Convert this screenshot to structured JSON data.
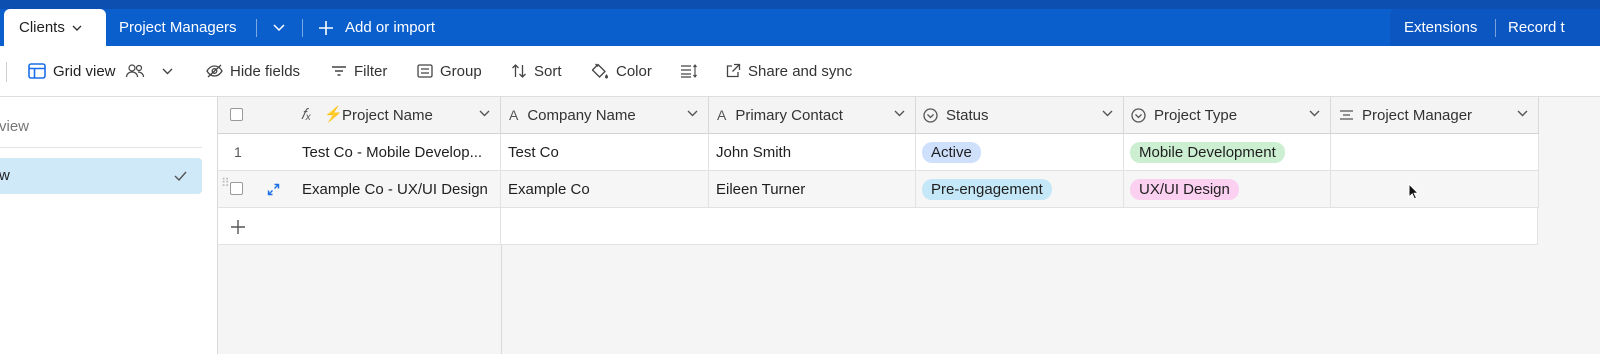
{
  "tabs": {
    "active_label": "Clients",
    "second_label": "Project Managers",
    "add_label": "Add or import",
    "extensions_label": "Extensions",
    "record_label": "Record t"
  },
  "toolbar": {
    "view_label": "Grid view",
    "hide_fields": "Hide fields",
    "filter": "Filter",
    "group": "Group",
    "sort": "Sort",
    "color": "Color",
    "share": "Share and sync"
  },
  "sidebar": {
    "search_fragment": "view",
    "selected_fragment": "w"
  },
  "grid": {
    "columns": [
      "Project Name",
      "Company Name",
      "Primary Contact",
      "Status",
      "Project Type",
      "Project Manager"
    ],
    "rows": [
      {
        "number": "1",
        "project_name": "Test Co - Mobile Develop...",
        "company": "Test Co",
        "contact": "John Smith",
        "status": "Active",
        "type": "Mobile Development",
        "manager": ""
      },
      {
        "number": "",
        "project_name": "Example Co - UX/UI Design",
        "company": "Example Co",
        "contact": "Eileen Turner",
        "status": "Pre-engagement",
        "type": "UX/UI Design",
        "manager": ""
      }
    ]
  },
  "colors": {
    "tab_bar": "#0a5fcd",
    "status_active_bg": "#cfe0fc",
    "status_pre_bg": "#c5e8f8",
    "type_mobile_bg": "#ccefd2",
    "type_ux_bg": "#fbd0f0",
    "sidebar_selected": "#cfe9f9"
  }
}
